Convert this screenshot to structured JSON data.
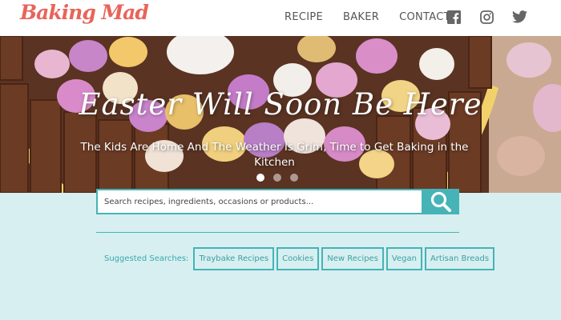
{
  "header": {
    "logo": "Baking Mad",
    "nav": [
      "RECIPE",
      "BAKER",
      "CONTACT"
    ],
    "social_icons": [
      "facebook-icon",
      "instagram-icon",
      "twitter-icon"
    ]
  },
  "hero": {
    "title": "Easter Will Soon Be Here",
    "subtitle": "The Kids Are Home And The Weather Is Grim, Time to Get Baking in the Kitchen",
    "slides_total": 3,
    "active_slide": 1
  },
  "search": {
    "placeholder": "Search recipes, ingredients, occasions or products...",
    "icon": "search-icon"
  },
  "suggested": {
    "label": "Suggested Searches:",
    "items": [
      "Traybake Recipes",
      "Cookies",
      "New Recipes",
      "Vegan",
      "Artisan Breads"
    ]
  },
  "colors": {
    "brand": "#e8645a",
    "accent": "#46b3b7",
    "background": "#d7eff0"
  }
}
